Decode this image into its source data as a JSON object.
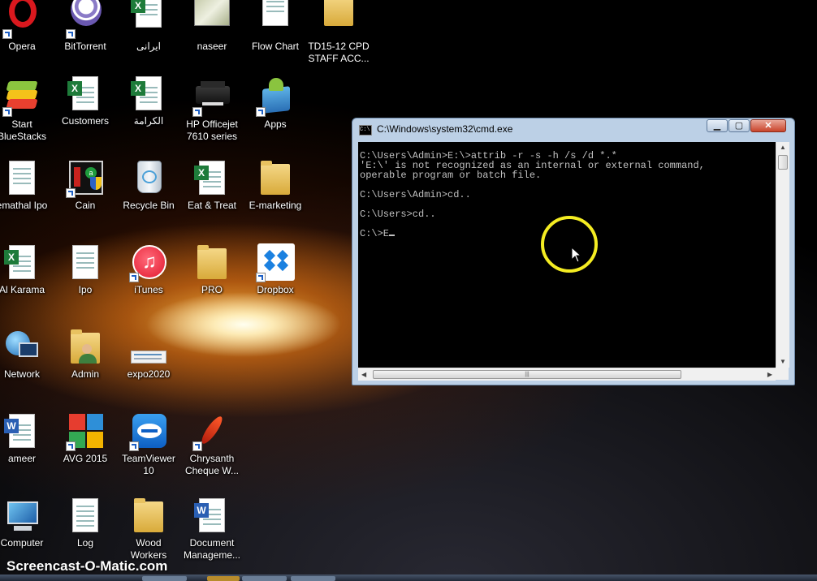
{
  "desktop": {
    "icons": [
      {
        "label": "Opera",
        "icon": "opera-icon",
        "shortcut": true
      },
      {
        "label": "BitTorrent",
        "icon": "bittorrent-icon",
        "shortcut": true
      },
      {
        "label": "ايرانی",
        "icon": "excel-file-icon",
        "shortcut": false
      },
      {
        "label": "naseer",
        "icon": "image-file-icon",
        "shortcut": false
      },
      {
        "label": "Flow Chart",
        "icon": "document-icon",
        "shortcut": false
      },
      {
        "label": "TD15-12 CPD\nSTAFF ACC...",
        "icon": "folder-icon",
        "shortcut": false
      },
      {
        "label": "Start\nBlueStacks",
        "icon": "bluestacks-icon",
        "shortcut": true
      },
      {
        "label": "Customers",
        "icon": "excel-file-icon",
        "shortcut": false
      },
      {
        "label": "الكرامة",
        "icon": "excel-file-icon",
        "shortcut": false
      },
      {
        "label": "HP Officejet\n7610 series",
        "icon": "printer-icon",
        "shortcut": true
      },
      {
        "label": "Apps",
        "icon": "apps-icon",
        "shortcut": true
      },
      {
        "label": "emathal Ipo",
        "icon": "document-icon",
        "shortcut": false
      },
      {
        "label": "Cain",
        "icon": "cain-icon",
        "shortcut": true
      },
      {
        "label": "Recycle Bin",
        "icon": "recycle-bin-icon",
        "shortcut": false
      },
      {
        "label": "Eat & Treat",
        "icon": "excel-file-icon",
        "shortcut": false
      },
      {
        "label": "E-marketing",
        "icon": "folder-icon",
        "shortcut": false
      },
      {
        "label": "Al Karama",
        "icon": "excel-file-icon",
        "shortcut": false
      },
      {
        "label": "Ipo",
        "icon": "document-icon",
        "shortcut": false
      },
      {
        "label": "iTunes",
        "icon": "itunes-icon",
        "shortcut": true
      },
      {
        "label": "PRO",
        "icon": "folder-icon",
        "shortcut": false
      },
      {
        "label": "Dropbox",
        "icon": "dropbox-icon",
        "shortcut": true
      },
      {
        "label": "Network",
        "icon": "network-icon",
        "shortcut": false
      },
      {
        "label": "Admin",
        "icon": "user-folder-icon",
        "shortcut": false
      },
      {
        "label": "expo2020",
        "icon": "image-file-icon",
        "shortcut": false
      },
      {
        "label": "ameer",
        "icon": "word-file-icon",
        "shortcut": false
      },
      {
        "label": "AVG 2015",
        "icon": "avg-icon",
        "shortcut": true
      },
      {
        "label": "TeamViewer\n10",
        "icon": "teamviewer-icon",
        "shortcut": true
      },
      {
        "label": "Chrysanth\nCheque W...",
        "icon": "feather-icon",
        "shortcut": true
      },
      {
        "label": "Computer",
        "icon": "computer-icon",
        "shortcut": false
      },
      {
        "label": "Log",
        "icon": "text-file-icon",
        "shortcut": false
      },
      {
        "label": "Wood\nWorkers",
        "icon": "folder-icon",
        "shortcut": false
      },
      {
        "label": "Document\nManageme...",
        "icon": "word-file-icon",
        "shortcut": false
      }
    ]
  },
  "cmd_window": {
    "title": "C:\\Windows\\system32\\cmd.exe",
    "title_icon_text": "C:\\",
    "minimize_label": "▁",
    "maximize_label": "▢",
    "close_label": "✕",
    "console_lines": [
      "C:\\Users\\Admin>E:\\>attrib -r -s -h /s /d *.*",
      "'E:\\' is not recognized as an internal or external command,",
      "operable program or batch file.",
      "",
      "C:\\Users\\Admin>cd..",
      "",
      "C:\\Users>cd..",
      "",
      "C:\\>E"
    ]
  },
  "watermark": "Screencast-O-Matic.com",
  "colors": {
    "console_bg": "#000000",
    "console_text": "#c0c0c0",
    "highlight_ring": "#f4ec22",
    "window_frame": "#bcd0e6"
  }
}
